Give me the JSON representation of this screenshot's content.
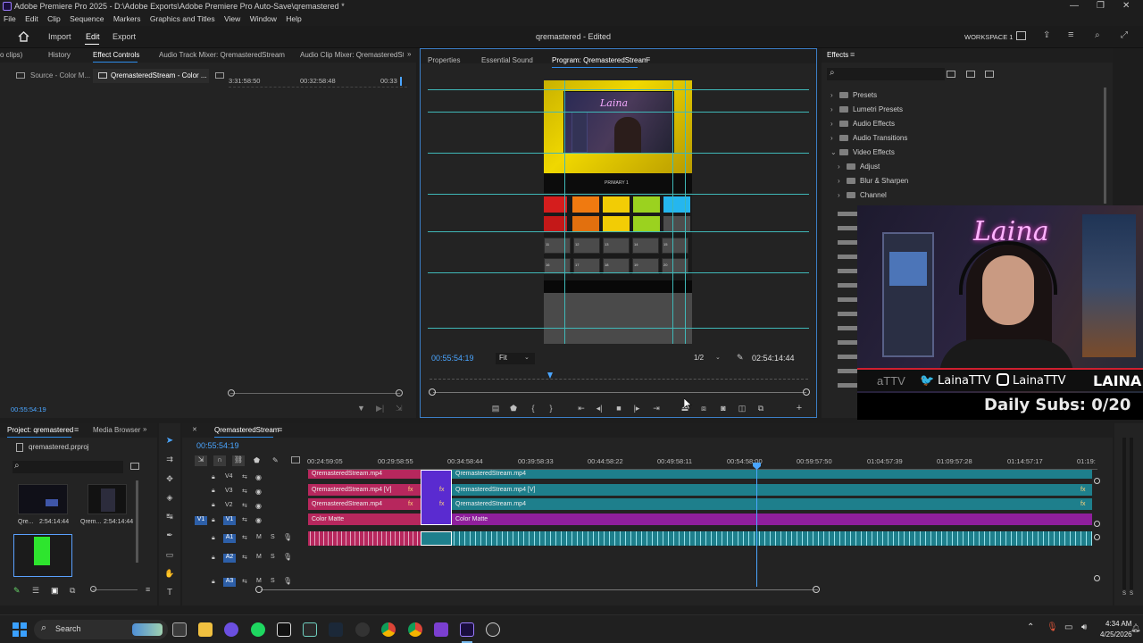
{
  "window": {
    "title": "Adobe Premiere Pro 2025 - D:\\Adobe Exports\\Adobe Premiere Pro Auto-Save\\qremastered *"
  },
  "menu": [
    "File",
    "Edit",
    "Clip",
    "Sequence",
    "Markers",
    "Graphics and Titles",
    "View",
    "Window",
    "Help"
  ],
  "header": {
    "home_icon": "home-icon",
    "tabs": [
      "Import",
      "Edit",
      "Export"
    ],
    "active_tab": "Edit",
    "project_title": "qremastered - Edited",
    "workspace": "WORKSPACE 1"
  },
  "effect_controls": {
    "tabs": [
      "o clips)",
      "History",
      "Effect Controls",
      "Audio Track Mixer: QremasteredStream",
      "Audio Clip Mixer: QremasteredStrea"
    ],
    "source": "Source - Color M...",
    "sequence": "QremasteredStream - Color ...",
    "ruler": [
      "3:31:58:50",
      "00:32:58:48",
      "00:33"
    ],
    "timecode": "00:55:54:19"
  },
  "program": {
    "tabs": [
      "Properties",
      "Essential Sound",
      "Program: QremasteredStream"
    ],
    "timecode": "00:55:54:19",
    "fit": "Fit",
    "resolution": "1/2",
    "duration": "02:54:14:44",
    "overlay_logo": "Laina",
    "overlay_label": "PRIMARY 1",
    "grid_numbers": [
      "11",
      "12",
      "13",
      "14",
      "15",
      "16",
      "17",
      "18",
      "19",
      "20"
    ]
  },
  "effects": {
    "title": "Effects",
    "search_placeholder": "",
    "items": [
      {
        "label": "Presets",
        "expanded": false,
        "level": 0
      },
      {
        "label": "Lumetri Presets",
        "expanded": false,
        "level": 0
      },
      {
        "label": "Audio Effects",
        "expanded": false,
        "level": 0
      },
      {
        "label": "Audio Transitions",
        "expanded": false,
        "level": 0
      },
      {
        "label": "Video Effects",
        "expanded": true,
        "level": 0
      },
      {
        "label": "Adjust",
        "expanded": false,
        "level": 1
      },
      {
        "label": "Blur & Sharpen",
        "expanded": false,
        "level": 1
      },
      {
        "label": "Channel",
        "expanded": false,
        "level": 1
      }
    ]
  },
  "webcam": {
    "name": "Laina",
    "twitter": "LainaTTV",
    "instagram": "LainaTTV",
    "brand": "LAINA",
    "handle_left": "aTTV",
    "subs": "Daily Subs: 0/20"
  },
  "project": {
    "tabs": [
      "Project: qremastered",
      "Media Browser"
    ],
    "file": "qremastered.prproj",
    "items": [
      {
        "name": "Qre...",
        "duration": "2:54:14:44"
      },
      {
        "name": "Qrem...",
        "duration": "2:54:14:44"
      }
    ]
  },
  "timeline": {
    "tab": "QremasteredStream",
    "timecode": "00:55:54:19",
    "ruler": [
      "00:24:59:05",
      "00:29:58:55",
      "00:34:58:44",
      "00:39:58:33",
      "00:44:58:22",
      "00:49:58:11",
      "00:54:58:00",
      "00:59:57:50",
      "01:04:57:39",
      "01:09:57:28",
      "01:14:57:17",
      "01:19:"
    ],
    "tracks": [
      {
        "name": "V4"
      },
      {
        "name": "V3"
      },
      {
        "name": "V2"
      },
      {
        "name": "V1",
        "source": "V1"
      },
      {
        "name": "A1",
        "source": "A1"
      },
      {
        "name": "A2"
      },
      {
        "name": "A3"
      }
    ],
    "clips": {
      "v4_left": "QremasteredStream.mp4",
      "v4_right": "QremasteredStream.mp4",
      "v3_left": "QremasteredStream.mp4 [V]",
      "v3_right": "QremasteredStream.mp4 [V]",
      "v2_left": "QremasteredStream.mp4",
      "v2_right": "QremasteredStream.mp4",
      "v1_left": "Color Matte",
      "v1_right": "Color Matte",
      "fx": "fx"
    }
  },
  "taskbar": {
    "search": "Search",
    "time": "4:34 AM",
    "date": "4/25/2026"
  }
}
